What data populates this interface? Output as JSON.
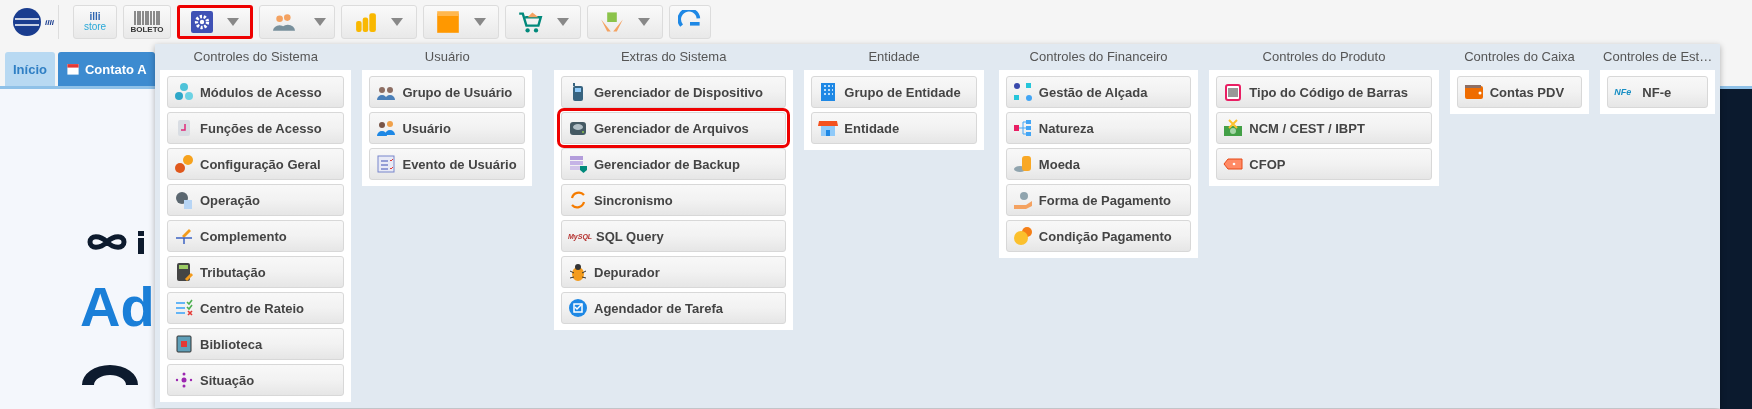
{
  "toolbar": [
    {
      "kind": "logo",
      "text": "illi"
    },
    {
      "kind": "store",
      "lines": [
        "illi",
        "store"
      ]
    },
    {
      "kind": "barcode",
      "text": "BOLETO"
    },
    {
      "kind": "dropdown",
      "selected": true
    },
    {
      "kind": "dropdown",
      "selected": false
    },
    {
      "kind": "dropdown",
      "selected": false
    },
    {
      "kind": "dropdown",
      "selected": false
    },
    {
      "kind": "dropdown",
      "selected": false
    },
    {
      "kind": "dropdown",
      "selected": false
    },
    {
      "kind": "refresh"
    }
  ],
  "tabs": [
    {
      "label": "Início",
      "selected": false
    },
    {
      "label": "Contato A",
      "selected": true
    }
  ],
  "page": {
    "heading": "Ad"
  },
  "menu": {
    "columns": [
      {
        "title": "Controles do Sistema",
        "items": [
          {
            "label": "Módulos de Acesso",
            "selected": false
          },
          {
            "label": "Funções de Acesso",
            "selected": false
          },
          {
            "label": "Configuração Geral",
            "selected": false
          },
          {
            "label": "Operação",
            "selected": false
          },
          {
            "label": "Complemento",
            "selected": false
          },
          {
            "label": "Tributação",
            "selected": false
          },
          {
            "label": "Centro de Rateio",
            "selected": false
          },
          {
            "label": "Biblioteca",
            "selected": false
          },
          {
            "label": "Situação",
            "selected": false
          }
        ]
      },
      {
        "title": "Usuário",
        "items": [
          {
            "label": "Grupo de Usuário",
            "selected": false
          },
          {
            "label": "Usuário",
            "selected": false
          },
          {
            "label": "Evento de Usuário",
            "selected": false
          }
        ]
      },
      {
        "title": "Extras do Sistema",
        "items": [
          {
            "label": "Gerenciador de Dispositivo",
            "selected": false
          },
          {
            "label": "Gerenciador de Arquivos",
            "selected": true
          },
          {
            "label": "Gerenciador de Backup",
            "selected": false
          },
          {
            "label": "Sincronismo",
            "selected": false
          },
          {
            "label": "SQL Query",
            "selected": false,
            "icon_text": "MySQL"
          },
          {
            "label": "Depurador",
            "selected": false
          },
          {
            "label": "Agendador de Tarefa",
            "selected": false
          }
        ]
      },
      {
        "title": "Entidade",
        "items": [
          {
            "label": "Grupo de Entidade",
            "selected": false
          },
          {
            "label": "Entidade",
            "selected": false
          }
        ]
      },
      {
        "title": "Controles do Financeiro",
        "items": [
          {
            "label": "Gestão de Alçada",
            "selected": false
          },
          {
            "label": "Natureza",
            "selected": false
          },
          {
            "label": "Moeda",
            "selected": false
          },
          {
            "label": "Forma de Pagamento",
            "selected": false
          },
          {
            "label": "Condição Pagamento",
            "selected": false
          }
        ]
      },
      {
        "title": "Controles do Produto",
        "items": [
          {
            "label": "Tipo do Código de Barras",
            "selected": false
          },
          {
            "label": "NCM / CEST / IBPT",
            "selected": false
          },
          {
            "label": "CFOP",
            "selected": false
          }
        ]
      },
      {
        "title": "Controles do Caixa",
        "items": [
          {
            "label": "Contas PDV",
            "selected": false
          }
        ]
      },
      {
        "title": "Controles de Est…",
        "items": [
          {
            "label": "NF-e",
            "selected": false,
            "icon_text": "NFe"
          }
        ]
      }
    ]
  }
}
